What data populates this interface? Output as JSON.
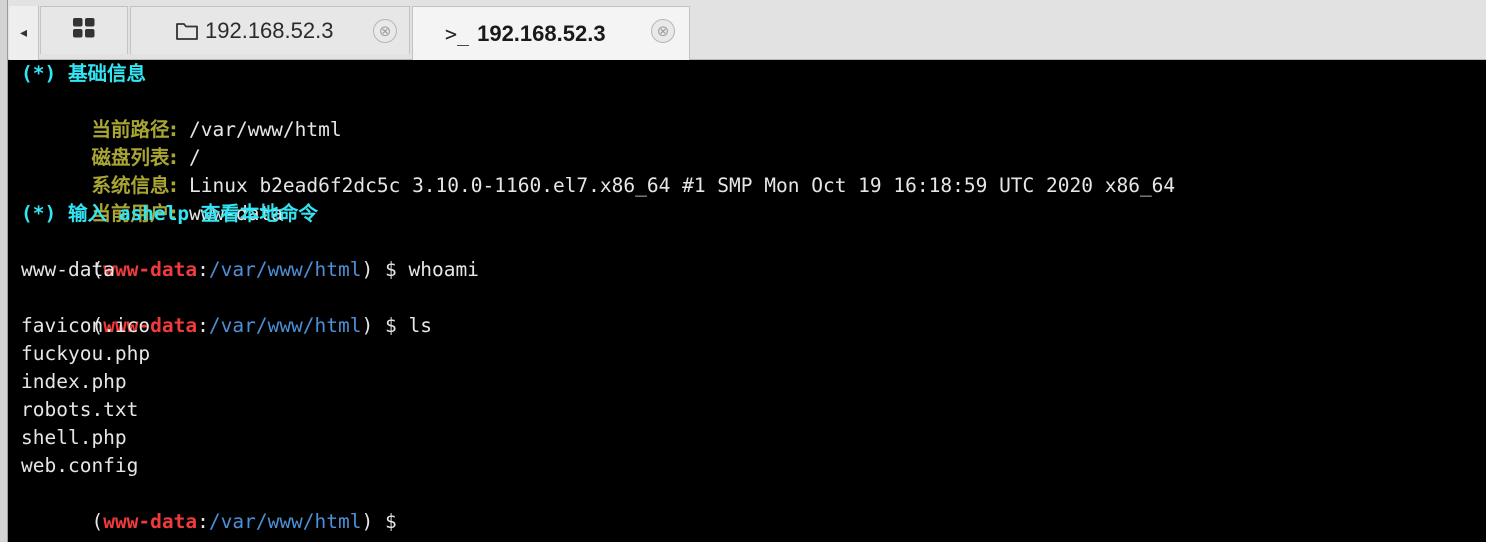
{
  "tabs": [
    {
      "icon": "grid-icon",
      "label": ""
    },
    {
      "icon": "folder-icon",
      "label": "192.168.52.3"
    },
    {
      "icon": "terminal-prompt-icon",
      "icon_text": ">_",
      "label": "192.168.52.3",
      "active": true
    }
  ],
  "tab_close_symbol": "⊗",
  "nav_left_symbol": "◂",
  "terminal": {
    "info_header": "(*) 基础信息",
    "current_path_key": "当前路径:",
    "current_path_val": " /var/www/html",
    "disk_list_key": "磁盘列表:",
    "disk_list_val": " /",
    "system_info_key": "系统信息:",
    "system_info_val": " Linux b2ead6f2dc5c 3.10.0-1160.el7.x86_64 #1 SMP Mon Oct 19 16:18:59 UTC 2020 x86_64",
    "current_user_key": "当前用户:",
    "current_user_val": " www-data",
    "help_hint": "(*) 输入 ashelp 查看本地命令",
    "prompt": {
      "open": "(",
      "user": "www-data",
      "colon": ":",
      "path": "/var/www/html",
      "close": ")",
      "dollar": " $ "
    },
    "cmd1": "whoami",
    "out1": "www-data",
    "cmd2": "ls",
    "files": [
      "favicon.ico",
      "fuckyou.php",
      "index.php",
      "robots.txt",
      "shell.php",
      "web.config"
    ]
  },
  "colors": {
    "header": "#33e5f2",
    "key": "#a8a534",
    "user": "#ef3b3b",
    "path": "#4d8fd6",
    "text": "#e6e6e6",
    "background": "#000000"
  }
}
